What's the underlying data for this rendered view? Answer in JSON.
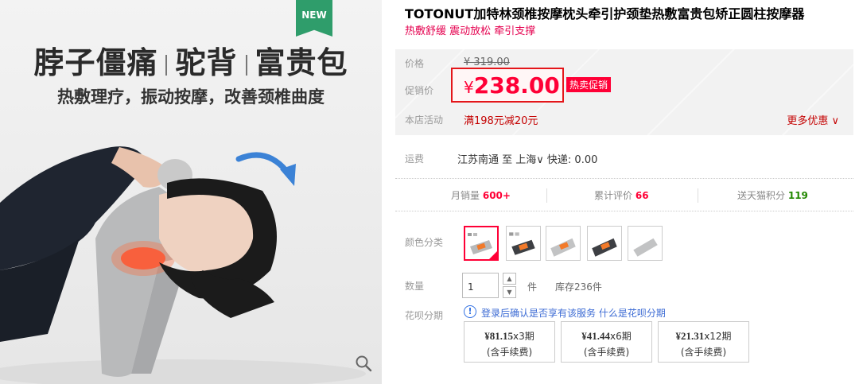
{
  "hero": {
    "badge": "NEW",
    "headline": [
      "脖子僵痛",
      "驼背",
      "富贵包"
    ],
    "subline": "热敷理疗，振动按摩，改善颈椎曲度",
    "zoom_icon": "magnifier-icon"
  },
  "product": {
    "title": "TOTONUT加特林颈椎按摩枕头牵引护颈垫热敷富贵包矫正圆柱按摩器",
    "subtitle": "热敷舒缓 震动放松 牵引支撑"
  },
  "price": {
    "orig_label": "价格",
    "orig_value": "¥ 319.00",
    "promo_label": "促销价",
    "promo_currency": "¥",
    "promo_value": "238.00",
    "promo_tag": "热卖促销",
    "activity_label": "本店活动",
    "activity_text": "满198元减20元",
    "more_promo": "更多优惠",
    "accent_color": "#ff0036"
  },
  "shipping": {
    "label": "运费",
    "text": "江苏南通  至 上海∨  快递: 0.00"
  },
  "stats": {
    "monthly_sales_label": "月销量",
    "monthly_sales_value": "600+",
    "reviews_label": "累计评价",
    "reviews_value": "66",
    "points_label": "送天猫积分",
    "points_value": "119"
  },
  "options": {
    "color_label": "颜色分类",
    "swatches": [
      {
        "name": "variant-1",
        "selected": true
      },
      {
        "name": "variant-2",
        "selected": false
      },
      {
        "name": "variant-3",
        "selected": false
      },
      {
        "name": "variant-4",
        "selected": false
      },
      {
        "name": "variant-5",
        "selected": false
      }
    ],
    "qty_label": "数量",
    "qty_value": "1",
    "qty_unit": "件",
    "stock": "库存236件"
  },
  "huabei": {
    "label": "花呗分期",
    "info_icon": "!",
    "notice": "登录后确认是否享有该服务",
    "link": "什么是花呗分期",
    "plans": [
      {
        "amount": "¥81.15",
        "periods": "x3期",
        "fee": "(含手续费)"
      },
      {
        "amount": "¥41.44",
        "periods": "x6期",
        "fee": "(含手续费)"
      },
      {
        "amount": "¥21.31",
        "periods": "x12期",
        "fee": "(含手续费)"
      }
    ]
  }
}
